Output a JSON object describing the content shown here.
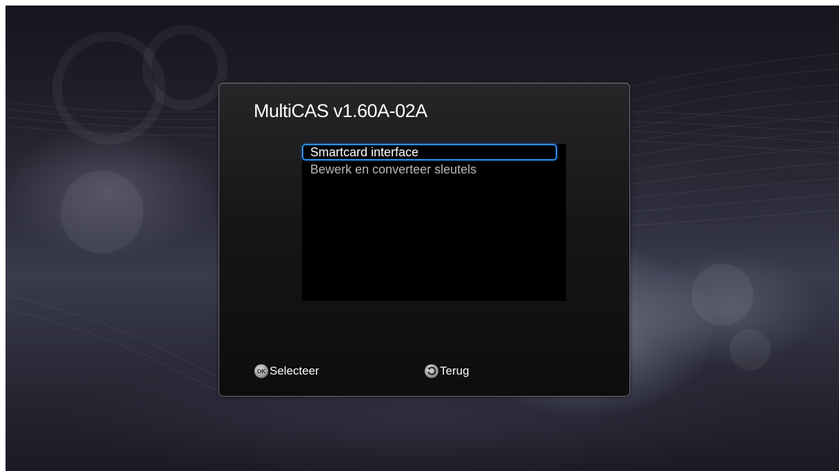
{
  "dialog": {
    "title": "MultiCAS v1.60A-02A",
    "menu_items": [
      {
        "label": "Smartcard interface",
        "selected": true
      },
      {
        "label": "Bewerk en converteer sleutels",
        "selected": false
      }
    ]
  },
  "footer": {
    "ok_icon_text": "OK",
    "ok_label": "Selecteer",
    "back_label": "Terug"
  },
  "colors": {
    "selection_border": "#2a8ff0",
    "menu_text": "#b8b8b8"
  },
  "icons": {
    "ok": "ok-button-icon",
    "back": "back-arrow-icon"
  }
}
